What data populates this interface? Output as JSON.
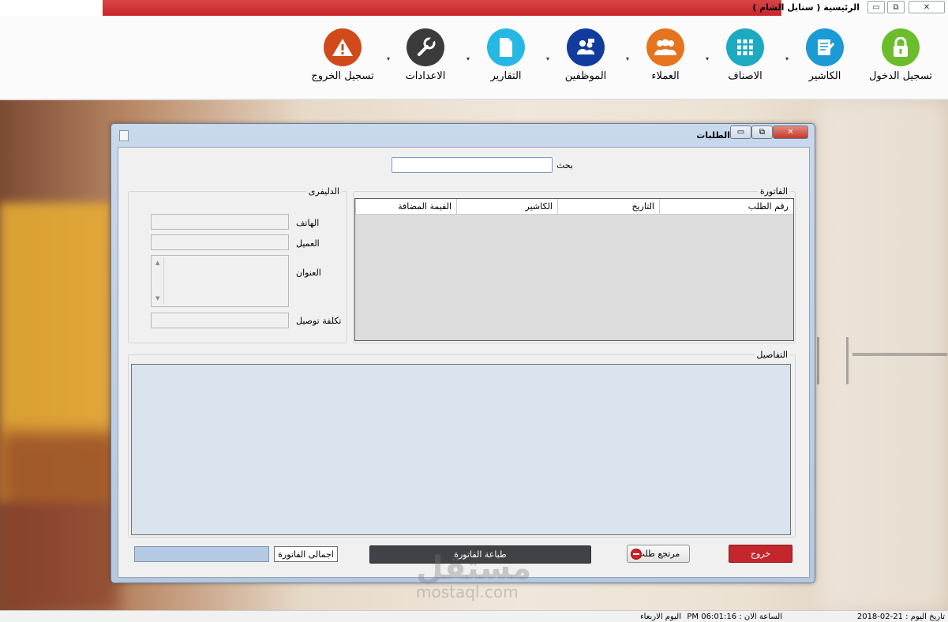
{
  "window": {
    "title": "الرئيسية  ( سنابل الشام )",
    "min_glyph": "▭",
    "max_glyph": "⧉",
    "close_glyph": "✕"
  },
  "ribbon": {
    "items": [
      {
        "label": "تسجيل الدخول",
        "icon": "lock-icon",
        "color": "#6cbd2b"
      },
      {
        "label": "الكاشير",
        "icon": "document-edit-icon",
        "color": "#1b9ad4"
      },
      {
        "label": "الاصناف",
        "icon": "grid-icon",
        "color": "#1caac1"
      },
      {
        "label": "العملاء",
        "icon": "people-icon",
        "color": "#e6731e"
      },
      {
        "label": "الموظفين",
        "icon": "messenger-people-icon",
        "color": "#123b9e"
      },
      {
        "label": "التقارير",
        "icon": "file-icon",
        "color": "#26b8e4"
      },
      {
        "label": "الاعدادات",
        "icon": "wrench-icon",
        "color": "#3b3b3b"
      },
      {
        "label": "تسجيل الخروج",
        "icon": "warning-icon",
        "color": "#d04a1a"
      }
    ],
    "caret": "▾"
  },
  "dialog": {
    "title": "الطلبات",
    "search": {
      "label": "بحث",
      "value": ""
    },
    "delivery": {
      "legend": "الدليفرى",
      "phone_label": "الهاتف",
      "phone_value": "",
      "customer_label": "العميل",
      "customer_value": "",
      "address_label": "العنوان",
      "address_value": "",
      "delivery_cost_label": "تكلفة توصيل",
      "delivery_cost_value": "",
      "scroll_up": "▲",
      "scroll_down": "▼"
    },
    "invoice": {
      "legend": "الفاتورة",
      "columns": [
        "رقم الطلب",
        "التاريخ",
        "الكاشير",
        "القيمة المضافة"
      ],
      "rows": []
    },
    "details": {
      "legend": "التفاصيل"
    },
    "footer": {
      "exit": "خروج",
      "return_order": "مرتجع طلب",
      "print_invoice": "طباعة الفاتورة",
      "invoice_total_label": "اجمالى الفاتورة",
      "invoice_total_value": ""
    }
  },
  "status_bar": {
    "date": "تاريخ اليوم : 21-02-2018",
    "time": "الساعة الان : PM 06:01:16",
    "day": "اليوم الاربعاء"
  },
  "watermark": {
    "brand": "مستقل",
    "site": "mostaql.com"
  },
  "colors": {
    "titlebar_red": "#c8262a",
    "exit_button": "#c3262c",
    "print_button": "#3f4347",
    "total_field": "#b4c9e4",
    "details_area": "#d9e4ef"
  }
}
